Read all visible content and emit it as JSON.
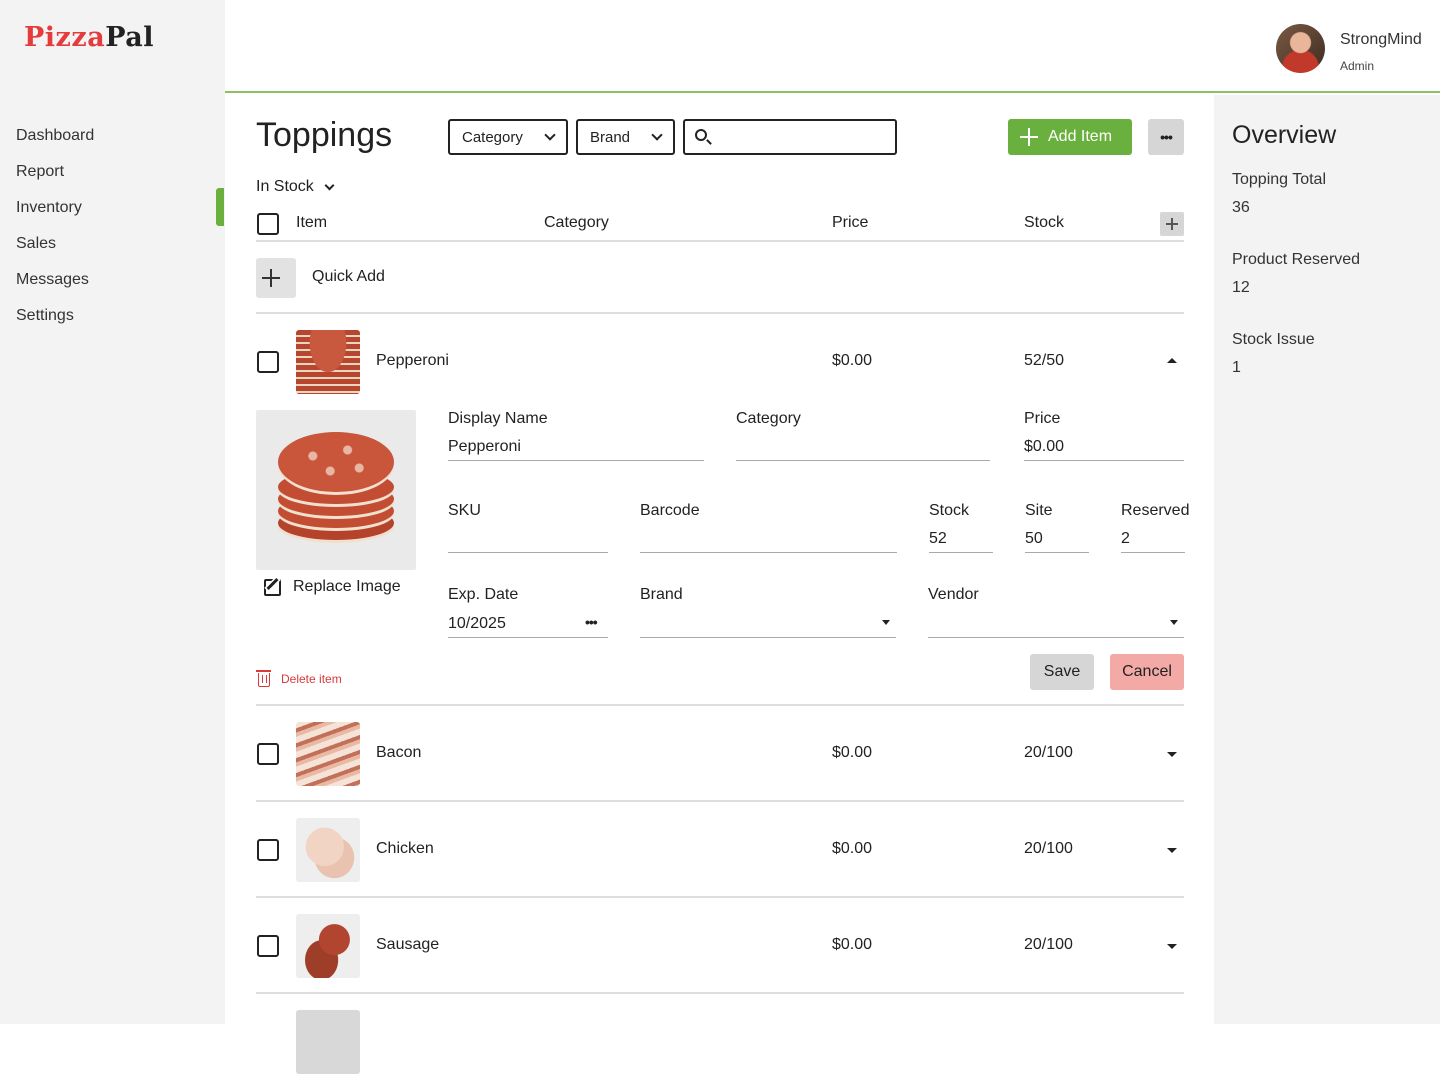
{
  "brand": {
    "part1": "Pizza",
    "part2": "Pal"
  },
  "nav": {
    "items": [
      "Dashboard",
      "Report",
      "Inventory",
      "Sales",
      "Messages",
      "Settings"
    ],
    "active": "Inventory"
  },
  "user": {
    "name": "StrongMind",
    "role": "Admin"
  },
  "page": {
    "title": "Toppings"
  },
  "toolbar": {
    "category_dropdown": "Category",
    "brand_dropdown": "Brand",
    "search_value": "",
    "add_label": "Add Item",
    "more_label": "•••"
  },
  "filter": {
    "label": "In Stock"
  },
  "table": {
    "headers": {
      "item": "Item",
      "category": "Category",
      "price": "Price",
      "stock": "Stock"
    }
  },
  "quick_add": {
    "label": "Quick Add"
  },
  "rows": [
    {
      "name": "Pepperoni",
      "price": "$0.00",
      "stock": "52/50",
      "expanded": true
    },
    {
      "name": "Bacon",
      "price": "$0.00",
      "stock": "20/100",
      "expanded": false
    },
    {
      "name": "Chicken",
      "price": "$0.00",
      "stock": "20/100",
      "expanded": false
    },
    {
      "name": "Sausage",
      "price": "$0.00",
      "stock": "20/100",
      "expanded": false
    }
  ],
  "detail": {
    "display_name_label": "Display Name",
    "display_name": "Pepperoni",
    "category_label": "Category",
    "category": "",
    "price_label": "Price",
    "price": "$0.00",
    "sku_label": "SKU",
    "sku": "",
    "barcode_label": "Barcode",
    "barcode": "",
    "stock_label": "Stock",
    "stock": "52",
    "site_label": "Site",
    "site": "50",
    "reserved_label": "Reserved",
    "reserved": "2",
    "exp_label": "Exp. Date",
    "exp": "10/2025",
    "brand_label": "Brand",
    "brand": "",
    "vendor_label": "Vendor",
    "vendor": "",
    "replace_label": "Replace Image",
    "delete_label": "Delete item",
    "save_label": "Save",
    "cancel_label": "Cancel",
    "more_label": "•••"
  },
  "overview": {
    "title": "Overview",
    "stats": [
      {
        "label": "Topping Total",
        "value": "36"
      },
      {
        "label": "Product Reserved",
        "value": "12"
      },
      {
        "label": "Stock Issue",
        "value": "1"
      }
    ]
  },
  "colors": {
    "accent": "#6ab03e",
    "danger": "#d93a3a",
    "cancel": "#f3a9a6",
    "brand_red": "#e43c3c"
  }
}
